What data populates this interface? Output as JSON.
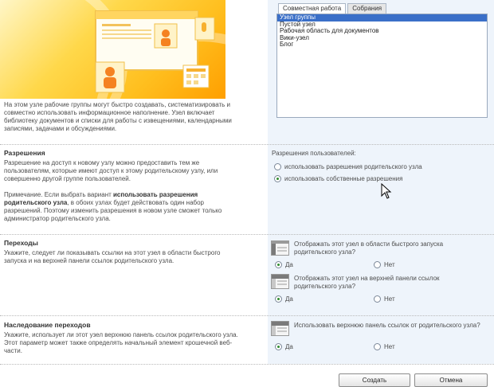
{
  "site_template": {
    "description": "На этом узле рабочие группы могут быстро создавать, систематизировать и совместно использовать информационное наполнение. Узел включает библиотеку документов и списки для работы с извещениями, календарными записями, задачами и обсуждениями.",
    "tabs": [
      {
        "label": "Совместная работа",
        "active": true
      },
      {
        "label": "Собрания",
        "active": false
      }
    ],
    "templates": [
      {
        "label": "Узел группы",
        "selected": true
      },
      {
        "label": "Пустой узел",
        "selected": false
      },
      {
        "label": "Рабочая область для документов",
        "selected": false
      },
      {
        "label": "Вики-узел",
        "selected": false
      },
      {
        "label": "Блог",
        "selected": false
      }
    ]
  },
  "permissions": {
    "title": "Разрешения",
    "text1": "Разрешение на доступ к новому узлу можно предоставить тем же пользователям, которые имеют доступ к этому родительскому узлу, или совершенно другой группе пользователей.",
    "note_prefix": "Примечание. Если выбрать вариант ",
    "note_bold": "использовать разрешения родительского узла",
    "note_suffix": ", в обоих узлах будет действовать один набор разрешений. Поэтому изменить разрешения в новом узле сможет только администратор родительского узла.",
    "field_label": "Разрешения пользователей:",
    "options": [
      {
        "label": "использовать разрешения родительского узла",
        "checked": false
      },
      {
        "label": "использовать собственные разрешения",
        "checked": true
      }
    ]
  },
  "navigation": {
    "title": "Переходы",
    "text": "Укажите, следует ли показывать ссылки на этот узел в области быстрого запуска и на верхней панели ссылок родительского узла.",
    "quick_launch": {
      "question": "Отображать этот узел в области быстрого запуска родительского узла?",
      "yes": "Да",
      "no": "Нет",
      "value": "yes"
    },
    "top_link_bar": {
      "question": "Отображать этот узел на верхней панели ссылок родительского узла?",
      "yes": "Да",
      "no": "Нет",
      "value": "yes"
    }
  },
  "navigation_inheritance": {
    "title": "Наследование переходов",
    "text": "Укажите, использует ли этот узел верхнюю панель ссылок родительского узла. Этот параметр может также определять начальный элемент крошечной веб-части.",
    "question": "Использовать верхнюю панель ссылок от родительского узла?",
    "yes": "Да",
    "no": "Нет",
    "value": "yes"
  },
  "buttons": {
    "create": "Создать",
    "cancel": "Отмена"
  },
  "colors": {
    "accent": "#3a6fc8",
    "panel": "#eef4fb",
    "hero": "#ffc21f"
  }
}
